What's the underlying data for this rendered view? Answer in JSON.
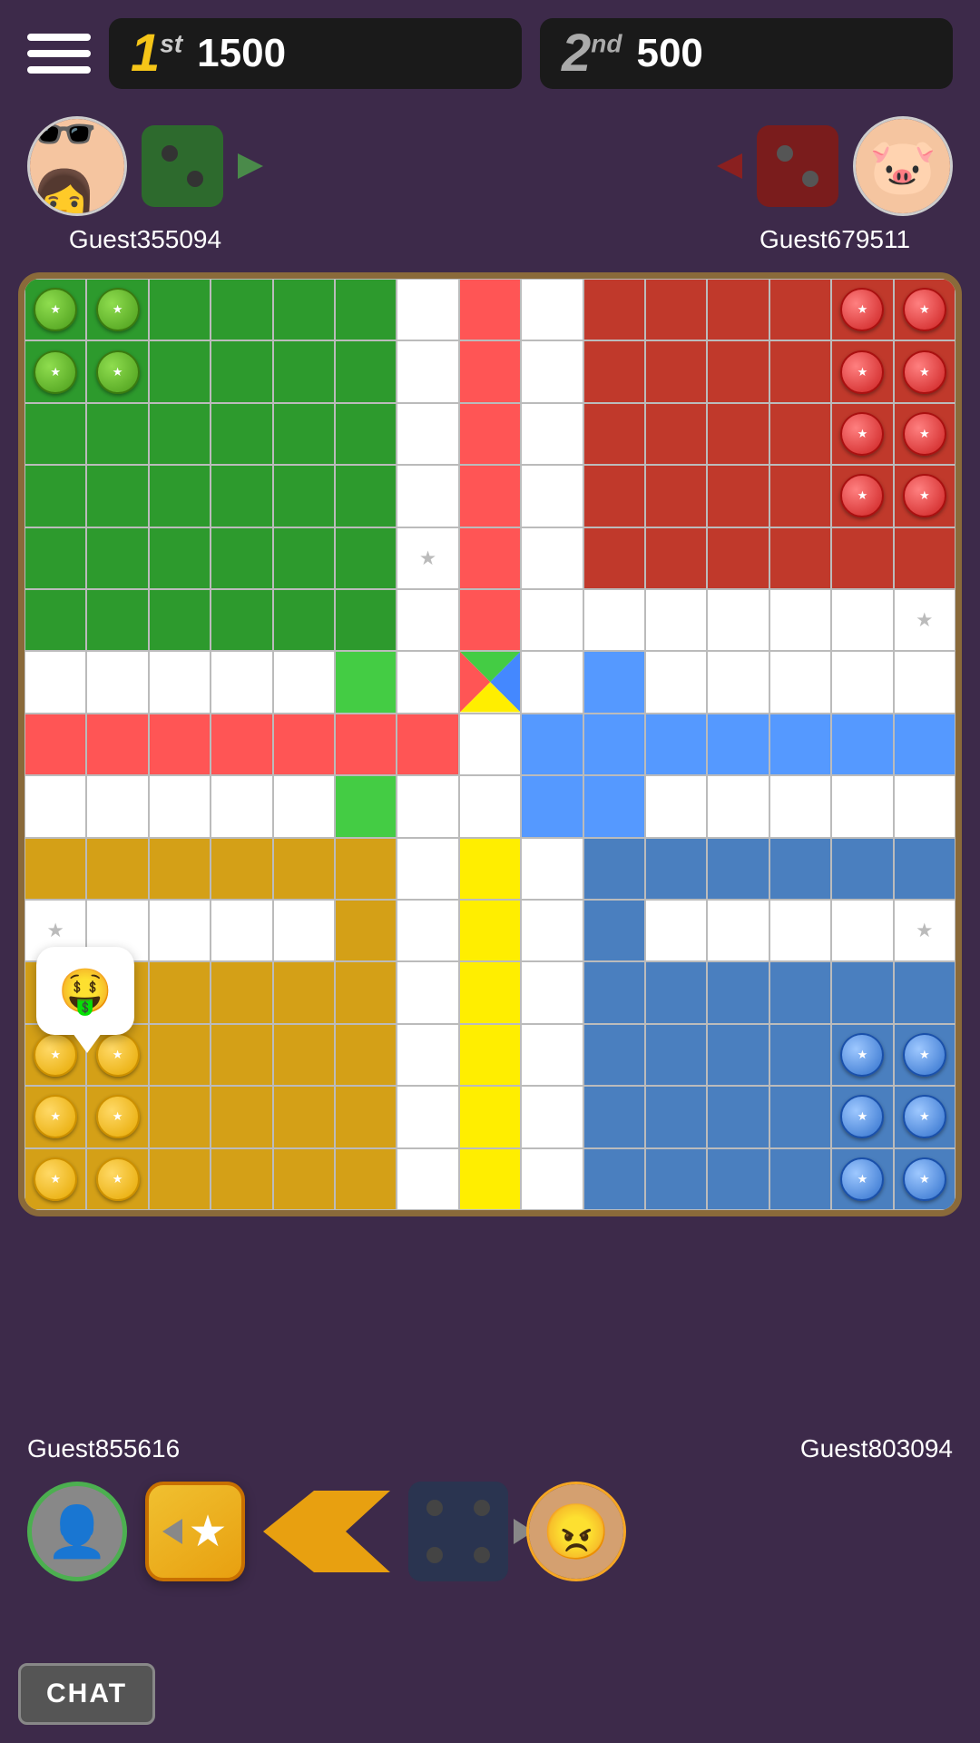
{
  "header": {
    "hamburger_label": "Menu",
    "first_place": {
      "rank": "1",
      "rank_sup": "st",
      "score": "1500"
    },
    "second_place": {
      "rank": "2",
      "rank_sup": "nd",
      "score": "500"
    }
  },
  "players": {
    "top_left": {
      "name": "Guest355094",
      "avatar": "lady"
    },
    "top_right": {
      "name": "Guest679511",
      "avatar": "pig"
    },
    "bottom_left": {
      "name": "Guest855616",
      "avatar": "guest"
    },
    "bottom_right": {
      "name": "Guest803094",
      "avatar": "bald"
    }
  },
  "chat": {
    "emoji": "🤑",
    "button_label": "CHAT"
  },
  "action_bar": {
    "star_button_icon": "★",
    "arrow_button": "←"
  }
}
